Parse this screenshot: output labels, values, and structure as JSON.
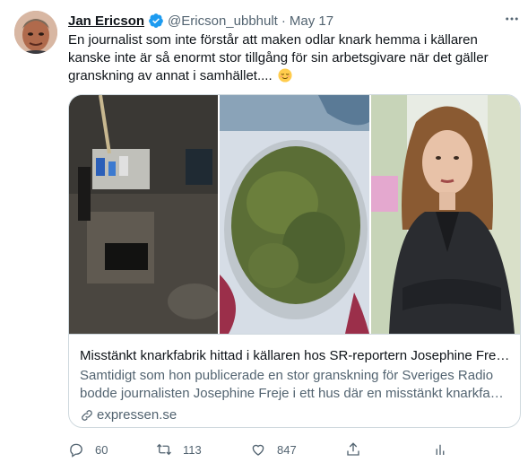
{
  "tweet": {
    "author_name": "Jan Ericson",
    "handle": "@Ericson_ubbhult",
    "separator": "·",
    "date": "May 17",
    "text": "En journalist som inte förstår att maken odlar knark hemma i källaren kanske inte är så enormt stor tillgång för sin arbetsgivare när det gäller granskning av annat i samhället....",
    "emoji": "relieved-face"
  },
  "card": {
    "title": "Misstänkt knarkfabrik hittad i källaren hos SR-reportern Josephine Frej...",
    "description_line1": "Samtidigt som hon publicerade en stor granskning för Sveriges Radio",
    "description_line2": "bodde journalisten Josephine Freje i ett hus där en misstänkt knarkfabr...",
    "domain": "expressen.se"
  },
  "actions": {
    "reply_count": "60",
    "retweet_count": "113",
    "like_count": "847"
  },
  "colors": {
    "text_primary": "#0f1419",
    "text_secondary": "#536471",
    "border": "#cfd9de",
    "verified": "#1d9bf0"
  }
}
